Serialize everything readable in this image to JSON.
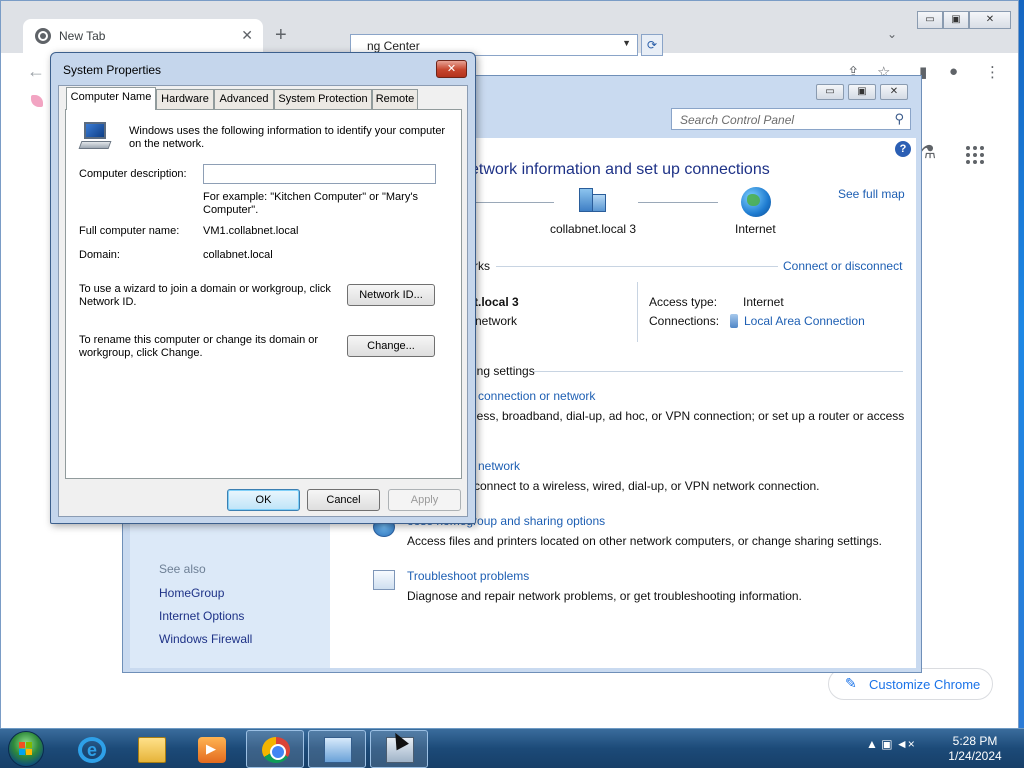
{
  "chrome": {
    "tab_title": "New Tab",
    "tab_close": "✕",
    "new_tab": "+",
    "dropdown": "⌄",
    "window_buttons": [
      "▭",
      "▣",
      "✕"
    ],
    "back": "←",
    "toolbar_icons": {
      "share": "⇪",
      "star": "☆",
      "sidepanel": "▮",
      "profile": "●",
      "menu": "⋮"
    },
    "labs": "⚗",
    "customize_label": "Customize Chrome",
    "customize_icon": "✎"
  },
  "control_panel": {
    "window_buttons": [
      "▭",
      "▣",
      "✕"
    ],
    "address_text": "ng Center",
    "address_dropdown": "▼",
    "refresh": "⟳",
    "search_placeholder": "Search Control Panel",
    "search_icon": "⚲",
    "help": "?",
    "heading": "etwork information and set up connections",
    "see_full_map": "See full map",
    "domain_node_label": "collabnet.local  3",
    "internet_node_label": "Internet",
    "active_networks_label": "rks",
    "connect_or_disconnect": "Connect or disconnect",
    "network_name": "t.local  3",
    "network_type": "network",
    "access_type_label": "Access type:",
    "access_type_value": "Internet",
    "connections_label": "Connections:",
    "connections_value": "Local Area Connection",
    "change_settings_label": "ing settings",
    "tasks": [
      {
        "title": "connection or network",
        "desc": "less, broadband, dial-up, ad hoc, or VPN connection; or set up a router or access"
      },
      {
        "title": "network",
        "desc": "connect to a wireless, wired, dial-up, or VPN network connection."
      },
      {
        "title": "oose homegroup and sharing options",
        "desc": "Access files and printers located on other network computers, or change sharing settings."
      },
      {
        "title": "Troubleshoot problems",
        "desc": "Diagnose and repair network problems, or get troubleshooting information."
      }
    ],
    "see_also": "See also",
    "see_also_links": [
      "HomeGroup",
      "Internet Options",
      "Windows Firewall"
    ]
  },
  "system_properties": {
    "title": "System Properties",
    "close": "✕",
    "tabs": [
      "Computer Name",
      "Hardware",
      "Advanced",
      "System Protection",
      "Remote"
    ],
    "active_tab": "Computer Name",
    "intro_line1": "Windows uses the following information to identify your computer",
    "intro_line2": "on the network.",
    "description_label": "Computer description:",
    "description_value": "",
    "example_line1": "For example: \"Kitchen Computer\" or \"Mary's",
    "example_line2": "Computer\".",
    "full_name_label": "Full computer name:",
    "full_name_value": "VM1.collabnet.local",
    "domain_label": "Domain:",
    "domain_value": "collabnet.local",
    "wizard_line1": "To use a wizard to join a domain or workgroup, click",
    "wizard_line2": "Network ID.",
    "network_id_button": "Network ID...",
    "rename_line1": "To rename this computer or change its domain or",
    "rename_line2": "workgroup, click Change.",
    "change_button": "Change...",
    "ok_button": "OK",
    "cancel_button": "Cancel",
    "apply_button": "Apply"
  },
  "taskbar": {
    "ie_glyph": "e",
    "tray_icons": "▲  ▣  ◄×",
    "time": "5:28 PM",
    "date": "1/24/2024"
  },
  "colors": {
    "link": "#1e5fb3",
    "heading": "#1e3287",
    "taskbar": "#1c4a78"
  }
}
